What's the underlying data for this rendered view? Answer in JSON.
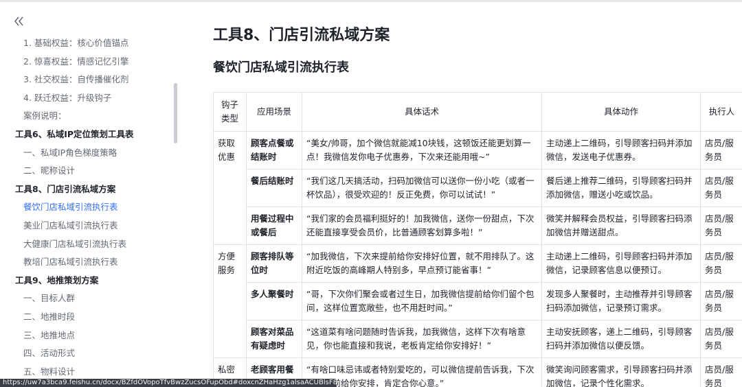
{
  "sidebar": {
    "items": [
      {
        "label": "1. 基础权益：核心价值锚点",
        "level": 2
      },
      {
        "label": "2. 惊喜权益：情感记忆引擎",
        "level": 2
      },
      {
        "label": "3. 社交权益：自传播催化剂",
        "level": 2
      },
      {
        "label": "4. 跃迁权益：升级钩子",
        "level": 2
      },
      {
        "label": "案例说明：",
        "level": 2
      },
      {
        "label": "工具6、私域IP定位策划工具表",
        "level": 1
      },
      {
        "label": "一、私域IP角色梯度策略",
        "level": 2
      },
      {
        "label": "二、昵称设计",
        "level": 2
      },
      {
        "label": "工具8、门店引流私域方案",
        "level": 1
      },
      {
        "label": "餐饮门店私域引流执行表",
        "level": 2,
        "active": true
      },
      {
        "label": "美业门店私域引流执行表",
        "level": 2
      },
      {
        "label": "大健康门店私域引流执行表",
        "level": 2
      },
      {
        "label": "教培门店私域引流执行表",
        "level": 2
      },
      {
        "label": "工具9、地推策划方案",
        "level": 1
      },
      {
        "label": "一、目标人群",
        "level": 2
      },
      {
        "label": "二、地推时段",
        "level": 2
      },
      {
        "label": "三、地推地点",
        "level": 2
      },
      {
        "label": "四、活动形式",
        "level": 2
      },
      {
        "label": "五、物料设计",
        "level": 2
      }
    ]
  },
  "main": {
    "title": "工具8、门店引流私域方案",
    "subtitle": "餐饮门店私域引流执行表",
    "table": {
      "headers": [
        "钩子类型",
        "应用场景",
        "具体话术",
        "具体动作",
        "执行人"
      ],
      "rows": [
        {
          "type": "获取优惠",
          "scene": "顾客点餐或结账时",
          "script": "“美女/帅哥，加个微信就能减10块钱，这顿饭还能更划算一点！我微信发你电子优惠券，下次来还能用哦~”",
          "action": "主动递上二维码，引导顾客扫码并添加微信，发送电子优惠券。",
          "executor": "店员/服务员"
        },
        {
          "type": "",
          "scene": "餐后结账时",
          "script": "“我们这几天搞活动，扫码加微信可以送你一份小吃（或者一杯饮品），很受欢迎的！反正免费，你可以试试！”",
          "action": "餐后递上推荐二维码，引导顾客扫码并添加微信，赠送小吃或饮品。",
          "executor": "店员/服务员"
        },
        {
          "type": "",
          "scene": "用餐过程中或餐后",
          "script": "“我们家的会员福利挺好的！加我微信，送你一份甜点，下次还能直接享受会员价，比普通顾客划算多啦！”",
          "action": "微笑并解释会员权益，引导顾客扫码添加微信并赠送甜点。",
          "executor": "店员/服务员"
        },
        {
          "type": "方便服务",
          "scene": "顾客排队等位时",
          "script": "“加我微信，下次来提前给你安排好位置，就不用排队了。这附近吃饭的高峰期人特别多，早点预订能省事！”",
          "action": "主动递上二维码，引导顾客扫码并添加微信，记录顾客信息以便预订。",
          "executor": "店员/服务员"
        },
        {
          "type": "",
          "scene": "多人聚餐时",
          "script": "“哥，下次你们聚会或者过生日，加我微信提前给你们留个包间，这样位置宽敞些，也不用赶时间。”",
          "action": "发现多人聚餐时，主动推荐并引导顾客扫码添加微信，记录预订需求。",
          "executor": "店员/服务员"
        },
        {
          "type": "",
          "scene": "顾客对菜品有疑虑时",
          "script": "“这道菜有啥问题随时告诉我，加我微信，这样下次有啥意见，你也能直接和我说，老板肯定给你安排好！”",
          "action": "主动安抚顾客，递上二维码，引导顾客扫码并添加微信以便反馈。",
          "executor": "店员/服务员"
        },
        {
          "type": "私密",
          "scene": "老顾客用餐",
          "script": "“有啥口味忌讳或者特别爱吃的，可以微信提前告诉我，下次来我提前给你安排，肯定合你心意。”",
          "action": "微笑询问顾客需求，引导顾客扫码并添加微信，记录个性化需求。",
          "executor": "店员/服务员"
        }
      ]
    }
  },
  "status_url": "https://uw7a3bca9.feishu.cn/docx/BZfdOVopoTfvBwzZucsOFupObd#doxcnZHaHzg1alsaACUBlsF8Pwh"
}
